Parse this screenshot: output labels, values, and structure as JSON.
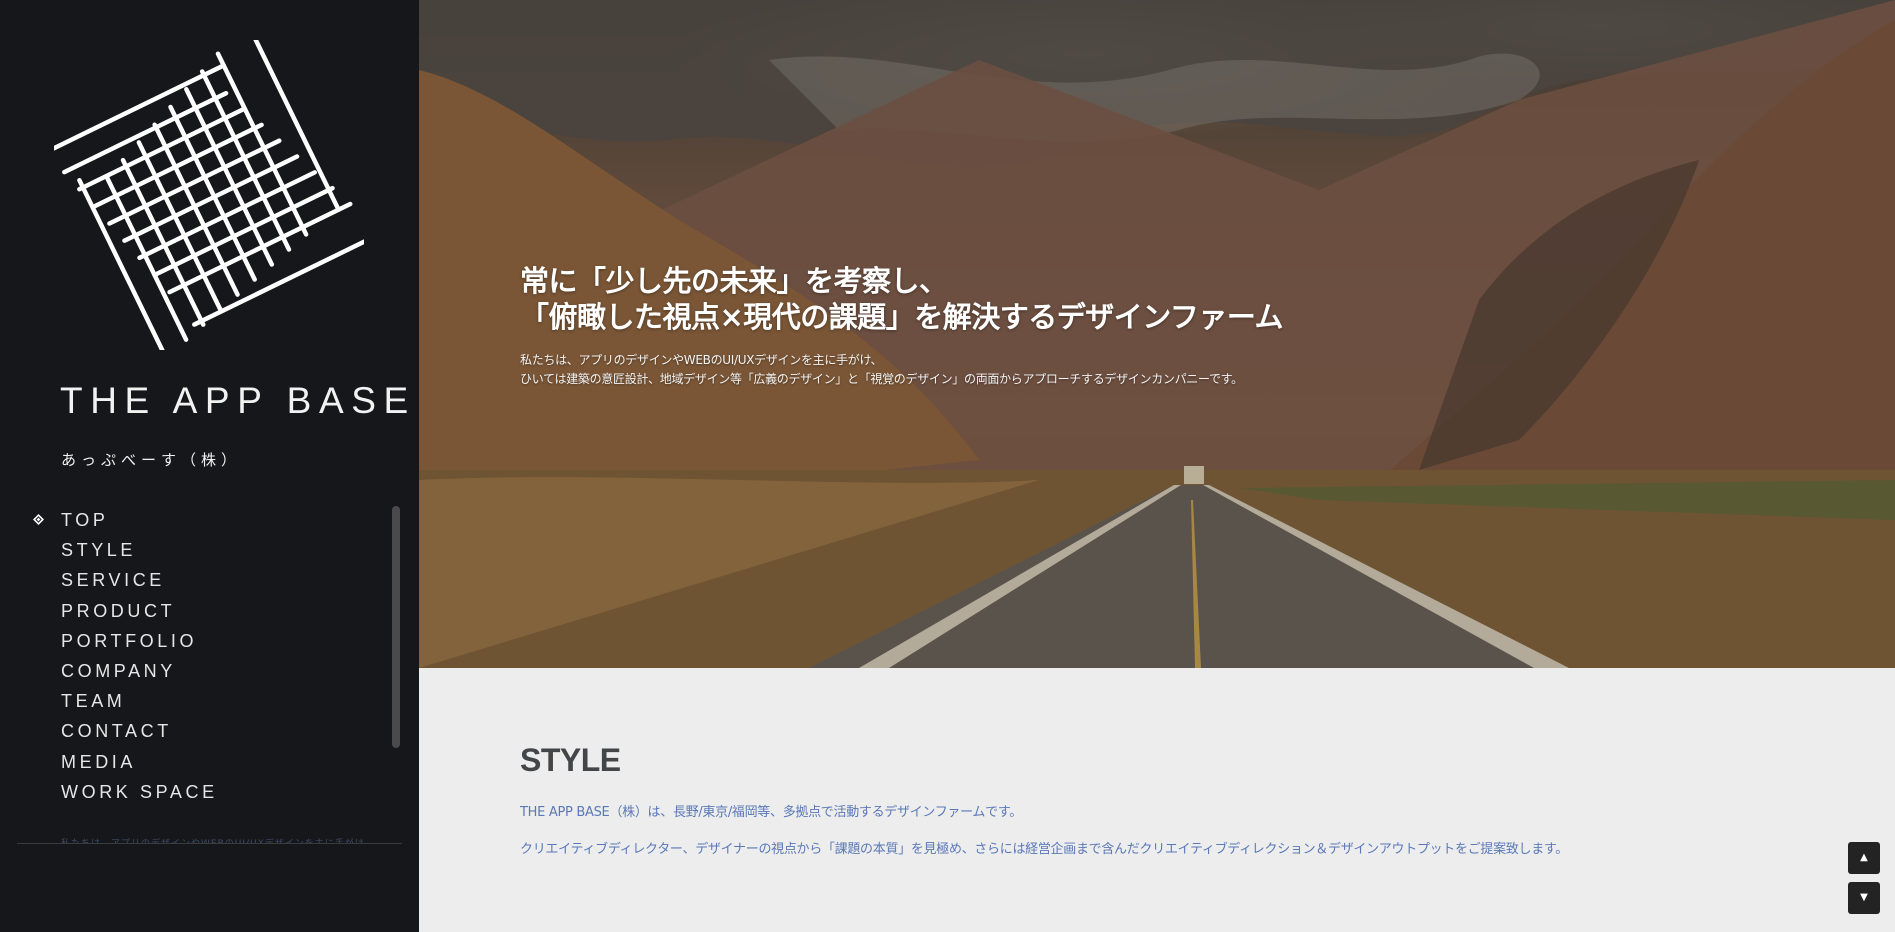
{
  "sidebar": {
    "logo_icon": "rotated-grid-logo",
    "brand_name": "THE APP BASE",
    "brand_name_jp": "あっぷべーす（株）",
    "active_indicator_icon": "diamond-icon",
    "nav_items": [
      {
        "label": "TOP",
        "active": true
      },
      {
        "label": "STYLE",
        "active": false
      },
      {
        "label": "SERVICE",
        "active": false
      },
      {
        "label": "PRODUCT",
        "active": false
      },
      {
        "label": "PORTFOLIO",
        "active": false
      },
      {
        "label": "COMPANY",
        "active": false
      },
      {
        "label": "TEAM",
        "active": false
      },
      {
        "label": "CONTACT",
        "active": false
      },
      {
        "label": "MEDIA",
        "active": false
      },
      {
        "label": "WORK SPACE",
        "active": false
      }
    ]
  },
  "hero": {
    "headline_line1": "常に「少し先の未来」を考察し、",
    "headline_line2": "「俯瞰した視点×現代の課題」を解決するデザインファーム",
    "description_line1": "私たちは、アプリのデザインやWEBのUI/UXデザインを主に手がけ、",
    "description_line2": "ひいては建築の意匠設計、地域デザイン等「広義のデザイン」と「視覚のデザイン」の両面からアプローチするデザインカンパニーです。"
  },
  "style_section": {
    "title": "STYLE",
    "paragraph1": "THE APP BASE（株）は、長野/東京/福岡等、多拠点で活動するデザインファームです。",
    "paragraph2": "クリエイティブディレクター、デザイナーの視点から「課題の本質」を見極め、さらには経営企画まで含んだクリエイティブディレクション＆デザインアウトプットをご提案致します。"
  },
  "scroll_controls": {
    "up_glyph": "▲",
    "down_glyph": "▼"
  },
  "colors": {
    "sidebar_bg": "#16171a",
    "page_bg": "#ededed",
    "link_blue": "#5a78b8",
    "heading_gray": "#444548"
  }
}
